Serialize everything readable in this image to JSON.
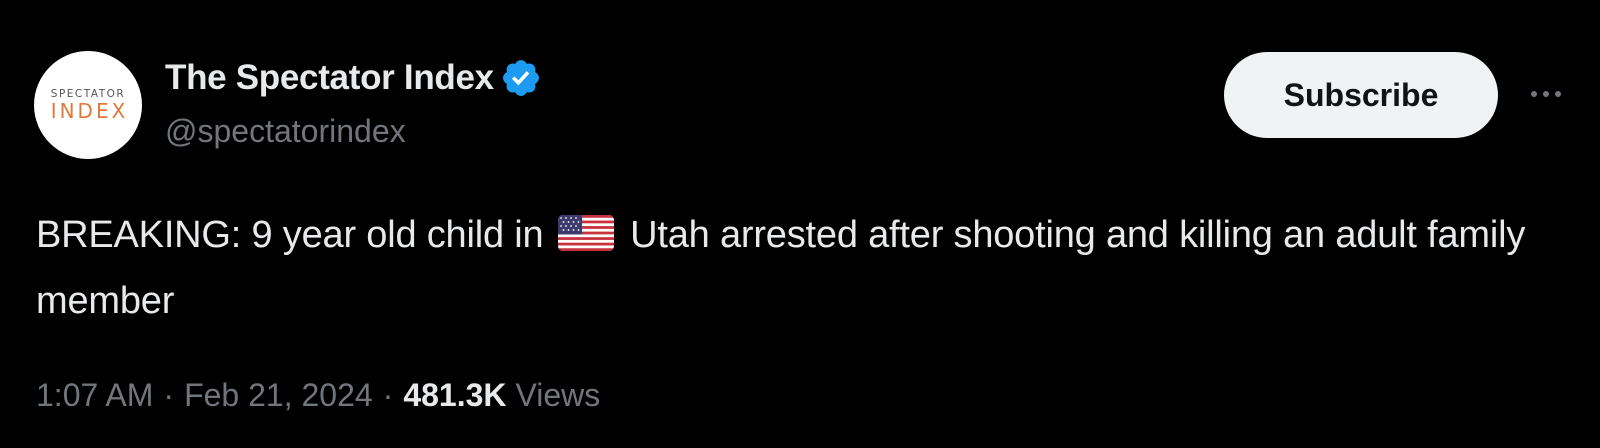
{
  "author": {
    "avatar_top_text": "SPECTATOR",
    "avatar_bottom_text": "INDEX",
    "display_name": "The Spectator Index",
    "handle": "@spectatorindex",
    "verified_icon": "verified-badge-icon"
  },
  "actions": {
    "subscribe_label": "Subscribe",
    "more_icon": "more-options-icon"
  },
  "tweet": {
    "text_before_flag": "BREAKING: 9 year old child in ",
    "flag_icon": "us-flag-icon",
    "text_after_flag": " Utah arrested after shooting and killing an adult family member"
  },
  "meta": {
    "time": "1:07 AM",
    "separator": "·",
    "date": "Feb 21, 2024",
    "views_count": "481.3K",
    "views_label": "Views"
  },
  "colors": {
    "background": "#000000",
    "primary_text": "#e7e9ea",
    "secondary_text": "#71767b",
    "verified_blue": "#1d9bf0",
    "button_bg": "#eff3f4",
    "button_text": "#0f1419"
  }
}
